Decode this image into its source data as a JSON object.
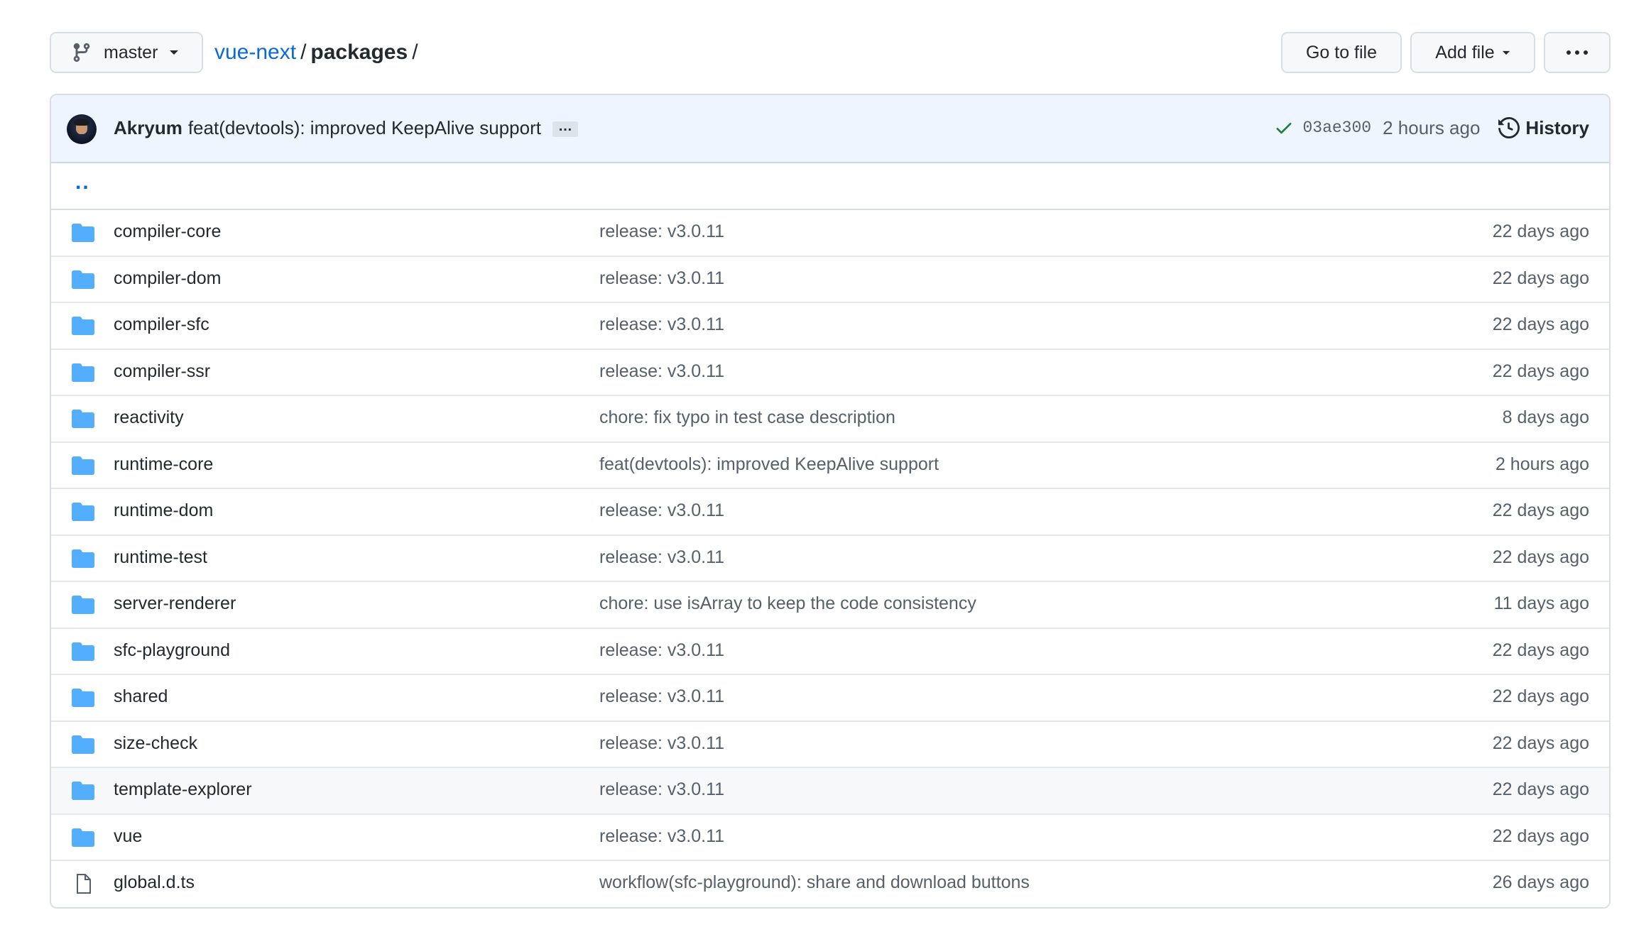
{
  "toolbar": {
    "branch": "master",
    "repo": "vue-next",
    "path_sep": "/",
    "dir": "packages",
    "trailing_sep": "/",
    "goto_file": "Go to file",
    "add_file": "Add file"
  },
  "commit": {
    "author": "Akryum",
    "message": "feat(devtools): improved KeepAlive support",
    "ellipsis": "…",
    "sha": "03ae300",
    "time": "2 hours ago",
    "history": "History",
    "status": "success"
  },
  "parent_link": "..",
  "files": [
    {
      "name": "compiler-core",
      "type": "dir",
      "message": "release: v3.0.11",
      "age": "22 days ago"
    },
    {
      "name": "compiler-dom",
      "type": "dir",
      "message": "release: v3.0.11",
      "age": "22 days ago"
    },
    {
      "name": "compiler-sfc",
      "type": "dir",
      "message": "release: v3.0.11",
      "age": "22 days ago"
    },
    {
      "name": "compiler-ssr",
      "type": "dir",
      "message": "release: v3.0.11",
      "age": "22 days ago"
    },
    {
      "name": "reactivity",
      "type": "dir",
      "message": "chore: fix typo in test case description",
      "age": "8 days ago"
    },
    {
      "name": "runtime-core",
      "type": "dir",
      "message": "feat(devtools): improved KeepAlive support",
      "age": "2 hours ago"
    },
    {
      "name": "runtime-dom",
      "type": "dir",
      "message": "release: v3.0.11",
      "age": "22 days ago"
    },
    {
      "name": "runtime-test",
      "type": "dir",
      "message": "release: v3.0.11",
      "age": "22 days ago"
    },
    {
      "name": "server-renderer",
      "type": "dir",
      "message": "chore: use isArray to keep the code consistency",
      "age": "11 days ago"
    },
    {
      "name": "sfc-playground",
      "type": "dir",
      "message": "release: v3.0.11",
      "age": "22 days ago"
    },
    {
      "name": "shared",
      "type": "dir",
      "message": "release: v3.0.11",
      "age": "22 days ago"
    },
    {
      "name": "size-check",
      "type": "dir",
      "message": "release: v3.0.11",
      "age": "22 days ago"
    },
    {
      "name": "template-explorer",
      "type": "dir",
      "message": "release: v3.0.11",
      "age": "22 days ago",
      "highlighted": true
    },
    {
      "name": "vue",
      "type": "dir",
      "message": "release: v3.0.11",
      "age": "22 days ago"
    },
    {
      "name": "global.d.ts",
      "type": "file",
      "message": "workflow(sfc-playground): share and download buttons",
      "age": "26 days ago"
    }
  ],
  "colors": {
    "link": "#0969da",
    "folder": "#54aeff",
    "check": "#1a7f37",
    "header_bg": "#eef5fe"
  },
  "icons": {
    "branch": "git-branch-icon",
    "folder": "folder-icon",
    "file": "file-icon",
    "check": "check-icon",
    "history": "history-icon",
    "more": "kebab-horizontal-icon"
  }
}
